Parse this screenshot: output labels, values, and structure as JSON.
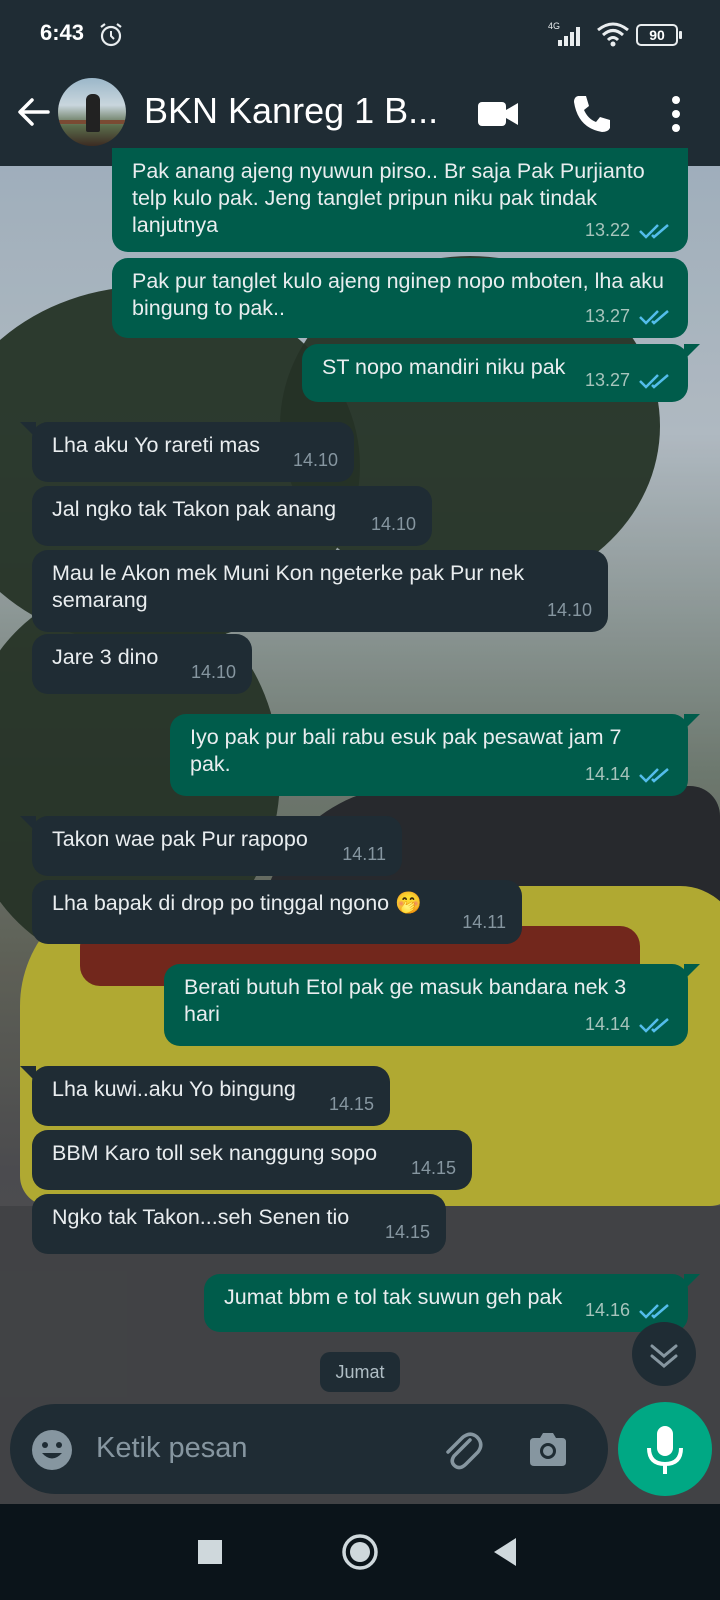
{
  "status_bar": {
    "time": "6:43",
    "network": "4G",
    "battery": "90"
  },
  "header": {
    "title": "BKN Kanreg 1 B..."
  },
  "messages": [
    {
      "dir": "out",
      "text": "Pak anang ajeng nyuwun pirso.. Br saja Pak Purjianto telp kulo pak. Jeng tanglet pripun niku pak tindak lanjutnya",
      "time": "13.22"
    },
    {
      "dir": "out",
      "text": "Pak pur tanglet kulo ajeng nginep nopo mboten, lha aku bingung to pak..",
      "time": "13.27"
    },
    {
      "dir": "out",
      "text": "ST nopo mandiri niku pak",
      "time": "13.27"
    },
    {
      "dir": "in",
      "text": "Lha aku Yo rareti mas",
      "time": "14.10"
    },
    {
      "dir": "in",
      "text": "Jal ngko tak Takon pak anang",
      "time": "14.10"
    },
    {
      "dir": "in",
      "text": "Mau le Akon mek Muni Kon ngeterke pak Pur nek semarang",
      "time": "14.10"
    },
    {
      "dir": "in",
      "text": "Jare 3 dino",
      "time": "14.10"
    },
    {
      "dir": "out",
      "text": "Iyo pak pur bali rabu esuk pak pesawat jam 7 pak.",
      "time": "14.14"
    },
    {
      "dir": "in",
      "text": "Takon wae pak Pur rapopo",
      "time": "14.11"
    },
    {
      "dir": "in",
      "text": "Lha bapak di drop po tinggal ngono 🤭",
      "time": "14.11"
    },
    {
      "dir": "out",
      "text": "Berati butuh Etol pak ge masuk bandara nek 3 hari",
      "time": "14.14"
    },
    {
      "dir": "in",
      "text": "Lha kuwi..aku Yo bingung",
      "time": "14.15"
    },
    {
      "dir": "in",
      "text": "BBM Karo toll sek nanggung sopo",
      "time": "14.15"
    },
    {
      "dir": "in",
      "text": "Ngko tak Takon...seh Senen tio",
      "time": "14.15"
    },
    {
      "dir": "out",
      "text": "Jumat bbm e tol tak suwun geh pak",
      "time": "14.16"
    }
  ],
  "date_chip": "Jumat",
  "composer": {
    "placeholder": "Ketik pesan"
  },
  "colors": {
    "header": "#1f2c34",
    "outgoing": "#005c4b",
    "incoming": "#1f2c34",
    "accent": "#00a884",
    "read_ticks": "#53bdeb"
  },
  "icons": [
    "back-arrow-icon",
    "video-call-icon",
    "phone-icon",
    "more-options-icon",
    "emoji-icon",
    "attach-icon",
    "camera-icon",
    "mic-icon",
    "scroll-down-icon",
    "nav-recents-icon",
    "nav-home-icon",
    "nav-back-icon"
  ]
}
